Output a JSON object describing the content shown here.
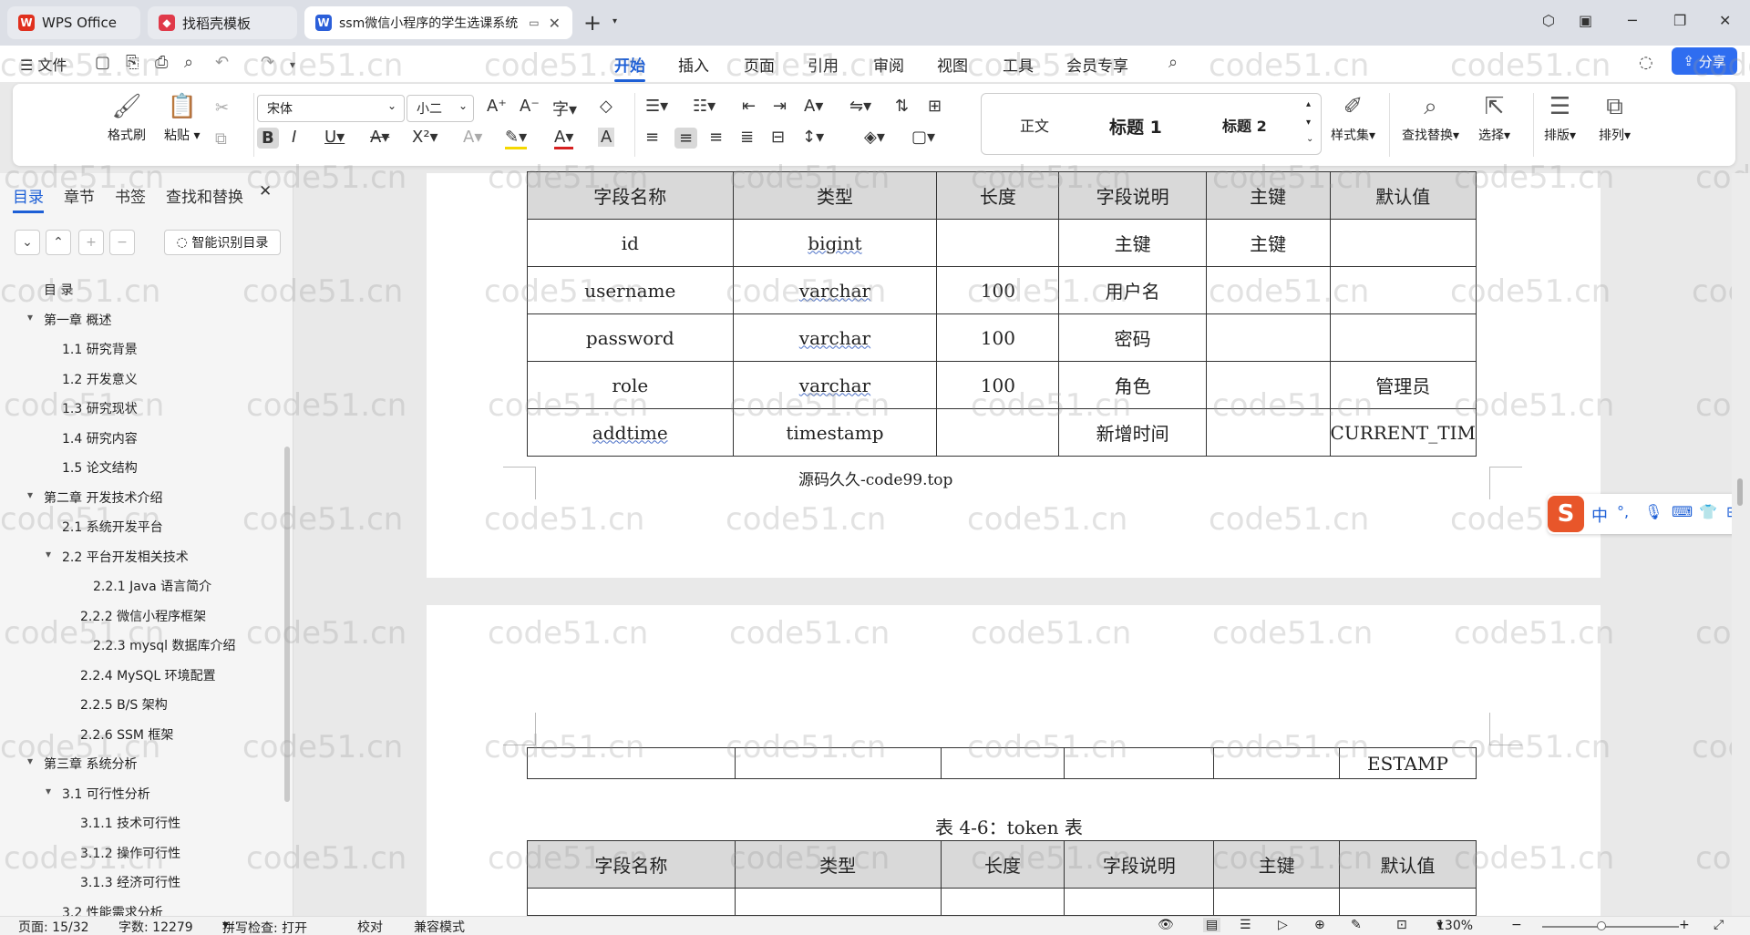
{
  "tabs": [
    {
      "label": "WPS Office",
      "icon": "wps-logo-icon",
      "color": "#e0301e"
    },
    {
      "label": "找稻壳模板",
      "icon": "docer-icon",
      "color": "#e03a4a"
    },
    {
      "label": "ssm微信小程序的学生选课系统",
      "icon": "word-icon",
      "color": "#2b5fd9"
    }
  ],
  "menu": {
    "file": "文件",
    "items": [
      "开始",
      "插入",
      "页面",
      "引用",
      "审阅",
      "视图",
      "工具",
      "会员专享"
    ],
    "active": "开始",
    "share": "分享"
  },
  "ribbon": {
    "format_painter": "格式刷",
    "paste": "粘贴",
    "font_name": "宋体",
    "font_size": "小二",
    "styles": [
      "正文",
      "标题 1",
      "标题 2"
    ],
    "style_set": "样式集",
    "find_replace": "查找替换",
    "select": "选择",
    "layout": "排版",
    "arrange": "排列",
    "accent_color": "#1d5fd6"
  },
  "sidebar": {
    "tabs": [
      "目录",
      "章节",
      "书签",
      "查找和替换"
    ],
    "smart_toc": "智能识别目录",
    "toc": [
      {
        "label": "目  录",
        "level": 0,
        "arrow": ""
      },
      {
        "label": "第一章 概述",
        "level": 0,
        "arrow": "▾"
      },
      {
        "label": "1.1 研究背景",
        "level": 1,
        "arrow": ""
      },
      {
        "label": "1.2 开发意义",
        "level": 1,
        "arrow": ""
      },
      {
        "label": "1.3 研究现状",
        "level": 1,
        "arrow": ""
      },
      {
        "label": "1.4 研究内容",
        "level": 1,
        "arrow": ""
      },
      {
        "label": "1.5 论文结构",
        "level": 1,
        "arrow": ""
      },
      {
        "label": "第二章 开发技术介绍",
        "level": 0,
        "arrow": "▾"
      },
      {
        "label": "2.1 系统开发平台",
        "level": 1,
        "arrow": ""
      },
      {
        "label": "2.2 平台开发相关技术",
        "level": 1,
        "arrow": "▾"
      },
      {
        "label": "2.2.1  Java 语言简介",
        "level": 3,
        "arrow": ""
      },
      {
        "label": "2.2.2  微信小程序框架",
        "level": 2,
        "arrow": ""
      },
      {
        "label": "2.2.3  mysql 数据库介绍",
        "level": 3,
        "arrow": ""
      },
      {
        "label": "2.2.4  MySQL 环境配置",
        "level": 2,
        "arrow": ""
      },
      {
        "label": "2.2.5  B/S 架构",
        "level": 2,
        "arrow": ""
      },
      {
        "label": "2.2.6  SSM 框架",
        "level": 2,
        "arrow": ""
      },
      {
        "label": "第三章 系统分析",
        "level": 0,
        "arrow": "▾"
      },
      {
        "label": "3.1 可行性分析",
        "level": 1,
        "arrow": "▾"
      },
      {
        "label": "3.1.1 技术可行性",
        "level": 2,
        "arrow": ""
      },
      {
        "label": "3.1.2 操作可行性",
        "level": 2,
        "arrow": ""
      },
      {
        "label": "3.1.3 经济可行性",
        "level": 2,
        "arrow": ""
      },
      {
        "label": "3.2 性能需求分析",
        "level": 1,
        "arrow": ""
      }
    ]
  },
  "document": {
    "table1": {
      "headers": [
        "字段名称",
        "类型",
        "长度",
        "字段说明",
        "主键",
        "默认值"
      ],
      "rows": [
        [
          "id",
          "bigint",
          "",
          "主键",
          "主键",
          ""
        ],
        [
          "username",
          "varchar",
          "100",
          "用户名",
          "",
          ""
        ],
        [
          "password",
          "varchar",
          "100",
          "密码",
          "",
          ""
        ],
        [
          "role",
          "varchar",
          "100",
          "角色",
          "",
          "管理员"
        ],
        [
          "addtime",
          "timestamp",
          "",
          "新增时间",
          "",
          "CURRENT_TIM"
        ]
      ]
    },
    "source_note": "源码久久-code99.top",
    "table1_continued": [
      "",
      "",
      "",
      "",
      "",
      "ESTAMP"
    ],
    "table2_caption": "表 4-6：token 表",
    "table2_headers": [
      "字段名称",
      "类型",
      "长度",
      "字段说明",
      "主键",
      "默认值"
    ],
    "watermark": "code51.cn"
  },
  "ime": {
    "mode": "中"
  },
  "status": {
    "page": "页面: 15/32",
    "words": "字数: 12279",
    "spell": "拼写检查: 打开",
    "proof": "校对",
    "compat": "兼容模式",
    "zoom": "130%",
    "zoom_fraction": 0.43
  }
}
